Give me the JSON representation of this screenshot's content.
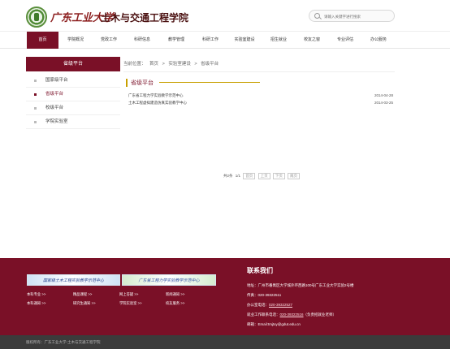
{
  "header": {
    "school_name": "广东工业大学",
    "college_name": "土木与交通工程学院",
    "search_placeholder": "请输入关键字进行搜索"
  },
  "nav": {
    "items": [
      "首页",
      "学院概况",
      "党政工作",
      "科研信息",
      "教学管理",
      "科研工作",
      "实验室建设",
      "招生就业",
      "校友之窗",
      "专业评估",
      "办公服务"
    ],
    "active_index": 0
  },
  "sidebar": {
    "title": "省级平台",
    "items": [
      "国家级平台",
      "省级平台",
      "校级平台",
      "学院实验室"
    ],
    "active_index": 1
  },
  "breadcrumb": {
    "prefix": "当前位置：",
    "items": [
      "首页",
      "实验室建设",
      "省级平台"
    ],
    "separator": ">"
  },
  "section": {
    "title": "省级平台"
  },
  "news": [
    {
      "title": "广东省工程力学实验教学示范中心",
      "date": "2014-04-28"
    },
    {
      "title": "土木工程虚拟建造仿真实验教学中心",
      "date": "2014-03-25"
    }
  ],
  "pager": {
    "total_label": "共2条",
    "page_label": "1/1",
    "first": "首页",
    "prev": "上页",
    "next": "下页",
    "last": "尾页"
  },
  "footer": {
    "banners": [
      "国家级土木工程实验教学示范中心",
      "广东省工程力学实验教学示范中心"
    ],
    "links": [
      [
        "本科专业 >>",
        "精品课程 >>",
        "网上答疑 >>",
        "新闻通知 >>"
      ],
      [
        "本科通知 >>",
        "研究生通知 >>",
        "学院实验室 >>",
        "校友服务 >>"
      ]
    ],
    "contact": {
      "title": "联系我们",
      "address": "地址：广州市番禺区大学城外环西路100号广东工业大学实验2号楼",
      "fax": "传真：020-39322511",
      "office_label": "办公室电话：",
      "office_phone": "020-39322527",
      "employ_label": "就业工作联系电话：",
      "employ_phone": "020-39322516",
      "employ_note": "（负责招就业老师）",
      "email": "邮箱：Email:tmjtxy@gdut.edu.cn"
    },
    "copyright": "版权所有：广东工业大学-土木与交通工程学院"
  }
}
